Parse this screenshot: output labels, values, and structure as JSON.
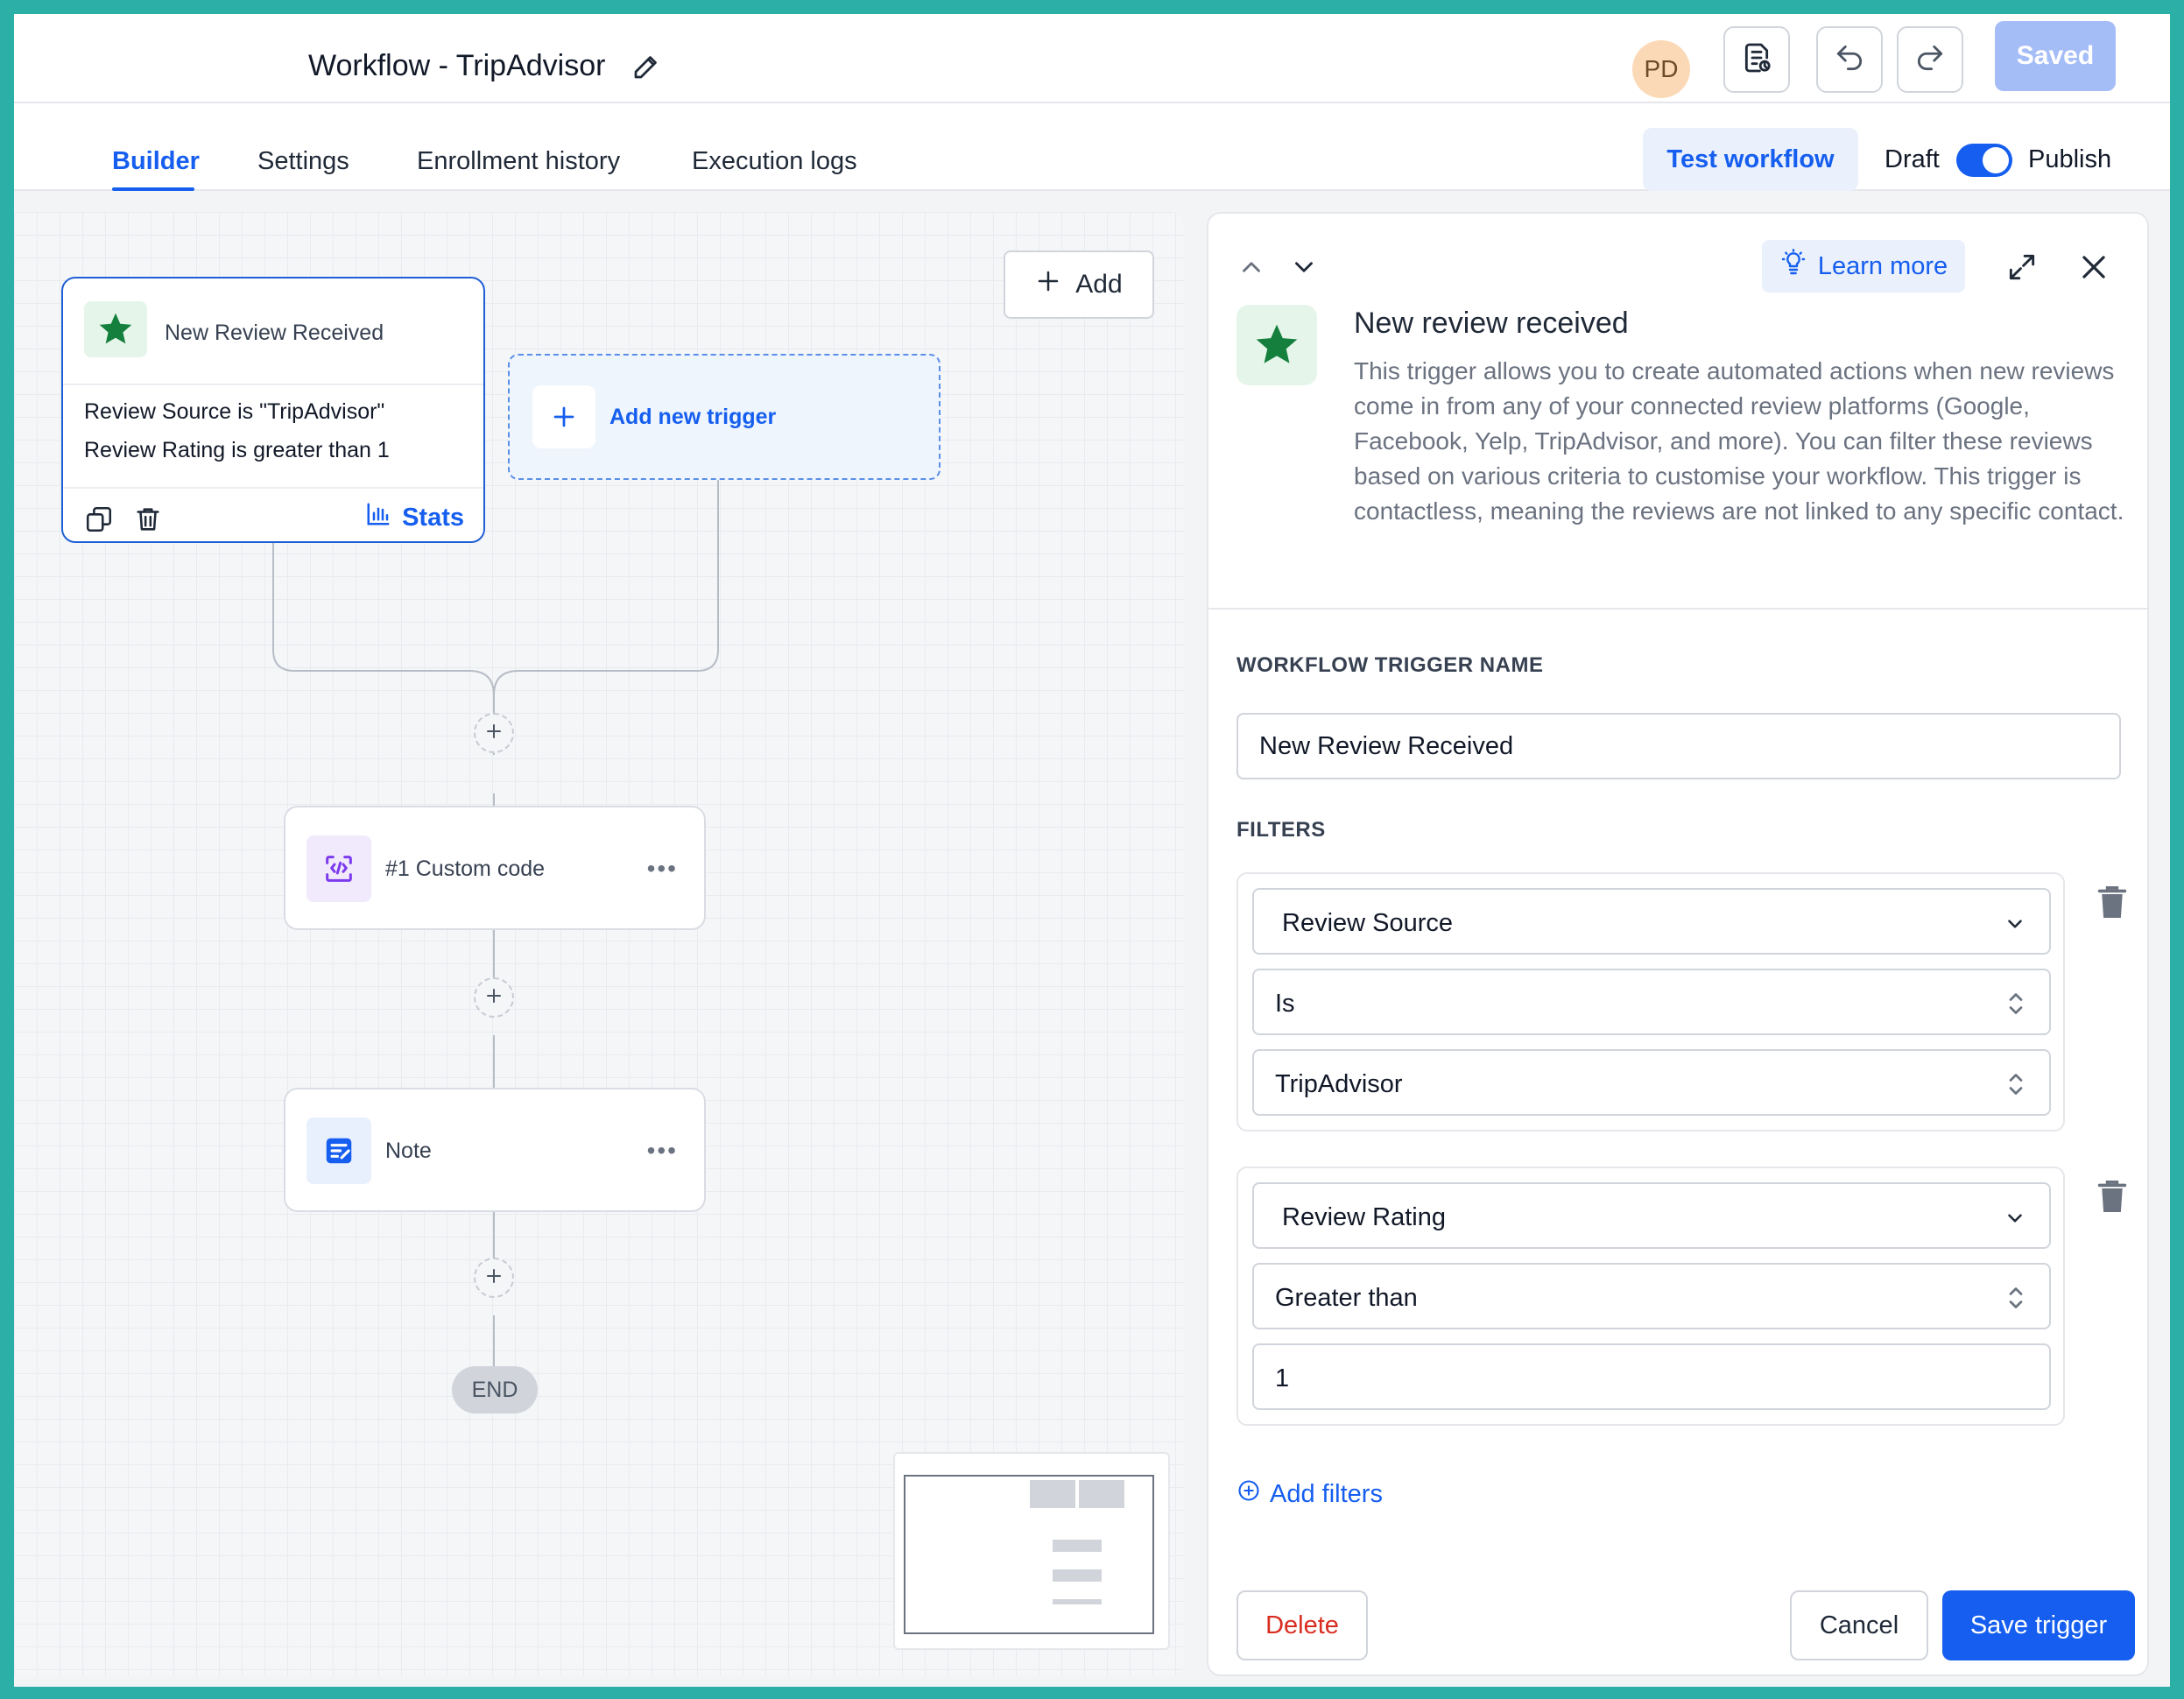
{
  "header": {
    "title": "Workflow - TripAdvisor",
    "avatar_initials": "PD",
    "saved_label": "Saved"
  },
  "tabs": {
    "builder": "Builder",
    "settings": "Settings",
    "enrollment": "Enrollment history",
    "execution": "Execution logs",
    "test_workflow": "Test workflow",
    "draft": "Draft",
    "publish": "Publish",
    "publish_toggle_on": true
  },
  "canvas": {
    "add_label": "Add",
    "trigger_node": {
      "title": "New Review Received",
      "conditions": [
        "Review Source is \"TripAdvisor\"",
        "Review Rating is greater than 1"
      ],
      "stats_label": "Stats"
    },
    "add_trigger_label": "Add new trigger",
    "steps": [
      {
        "label": "#1 Custom code",
        "icon": "code-icon"
      },
      {
        "label": "Note",
        "icon": "note-icon"
      }
    ],
    "end_label": "END"
  },
  "panel": {
    "learn_more": "Learn more",
    "title": "New review received",
    "description": "This trigger allows you to create automated actions when new reviews come in from any of your connected review platforms (Google, Facebook, Yelp, TripAdvisor, and more). You can filter these reviews based on various criteria to customise your workflow. This trigger is contactless, meaning the reviews are not linked to any specific contact.",
    "trigger_name_label": "WORKFLOW TRIGGER NAME",
    "trigger_name_value": "New Review Received",
    "filters_label": "FILTERS",
    "filters": [
      {
        "field": "Review Source",
        "operator": "Is",
        "value": "TripAdvisor"
      },
      {
        "field": "Review Rating",
        "operator": "Greater than",
        "value": "1"
      }
    ],
    "add_filters": "Add filters",
    "delete": "Delete",
    "cancel": "Cancel",
    "save": "Save trigger"
  },
  "colors": {
    "accent": "#155eef",
    "danger": "#d92d20",
    "star_green": "#15803d",
    "frame_teal": "#2bafa7"
  }
}
